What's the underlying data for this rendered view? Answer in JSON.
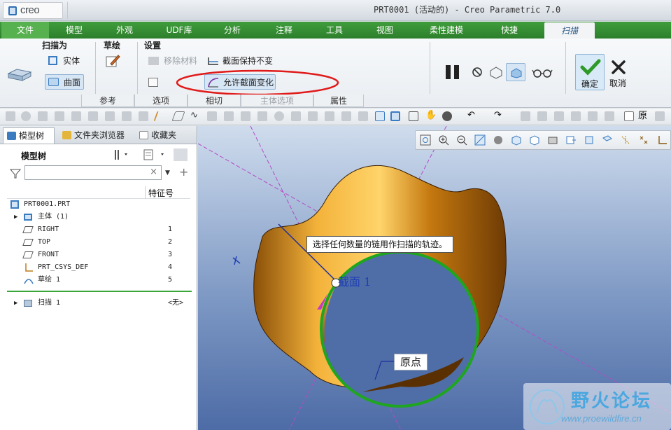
{
  "window": {
    "logo_text": "creo",
    "title": "PRT0001 (活动的) - Creo Parametric 7.0"
  },
  "menu_tabs": [
    {
      "label": "文件"
    },
    {
      "label": "模型"
    },
    {
      "label": "外观"
    },
    {
      "label": "UDF库"
    },
    {
      "label": "分析"
    },
    {
      "label": "注释"
    },
    {
      "label": "工具"
    },
    {
      "label": "视图"
    },
    {
      "label": "柔性建模"
    },
    {
      "label": "快捷"
    },
    {
      "label": "扫描"
    }
  ],
  "ribbon": {
    "sweep_as": {
      "title": "扫描为",
      "solid": "实体",
      "surface": "曲面"
    },
    "sketch": {
      "title": "草绘"
    },
    "settings": {
      "title": "设置",
      "remove_material": "移除材料",
      "keep_section": "截面保持不变",
      "allow_section_change": "允许截面变化"
    },
    "bottom_tabs": [
      "参考",
      "选项",
      "相切",
      "主体选项",
      "属性"
    ],
    "ok_label": "确定",
    "cancel_label": "取消"
  },
  "left_panel": {
    "tabs": [
      "模型树",
      "文件夹浏览器",
      "收藏夹"
    ],
    "tree_title": "模型树",
    "column_header": "特征号",
    "search_placeholder": "",
    "rows": [
      {
        "label": "PRT0001.PRT",
        "num": ""
      },
      {
        "label": "主体 (1)",
        "num": ""
      },
      {
        "label": "RIGHT",
        "num": "1"
      },
      {
        "label": "TOP",
        "num": "2"
      },
      {
        "label": "FRONT",
        "num": "3"
      },
      {
        "label": "PRT_CSYS_DEF",
        "num": "4"
      },
      {
        "label": "草绘 1",
        "num": "5"
      },
      {
        "label": "扫描 1",
        "num": "<无>"
      }
    ]
  },
  "viewport": {
    "tooltip": "选择任何数量的链用作扫描的轨迹。",
    "section_label": "截面 1",
    "origin_label": "原点",
    "watermark_title": "野火论坛",
    "watermark_url": "www.proewildfire.cn"
  },
  "colors": {
    "tab_green": "#2d7f2b",
    "trajectory_green": "#1fa51f",
    "surface_orange": "#e09a20",
    "highlight_red": "#e01a1a"
  }
}
